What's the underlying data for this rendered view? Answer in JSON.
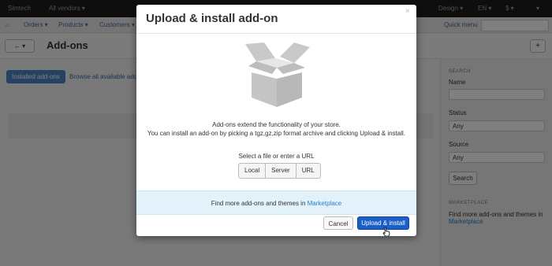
{
  "topbar": {
    "brand": "Simtech",
    "vendors": "All vendors ▾",
    "design": "Design ▾",
    "lang": "EN ▾",
    "currency": "$ ▾",
    "settings": "▾"
  },
  "menubar": {
    "home_icon": "home-icon",
    "orders": "Orders ▾",
    "products": "Products ▾",
    "customers": "Customers ▾",
    "quick_menu": "Quick menu"
  },
  "header": {
    "back": "← ▾",
    "title": "Add-ons",
    "add": "+"
  },
  "tabs": {
    "installed": "Installed add-ons",
    "browse": "Browse all available add"
  },
  "sidebar": {
    "search_heading": "SEARCH",
    "name_label": "Name",
    "status_label": "Status",
    "status_value": "Any",
    "source_label": "Source",
    "source_value": "Any",
    "search_button": "Search",
    "marketplace_heading": "MARKETPLACE",
    "marketplace_text": "Find more add-ons and themes in",
    "marketplace_link": "Marketplace"
  },
  "modal": {
    "title": "Upload & install add-on",
    "close": "×",
    "icon": "open-box-icon",
    "description_line1": "Add-ons extend the functionality of your store.",
    "description_line2": "You can install an add-on by picking a tgz,gz,zip format archive and clicking Upload & install.",
    "select_label": "Select a file or enter a URL",
    "source_options": [
      "Local",
      "Server",
      "URL"
    ],
    "marketplace_text": "Find more add-ons and themes in",
    "marketplace_link": "Marketplace",
    "cancel_label": "Cancel",
    "upload_label": "Upload & install"
  },
  "colors": {
    "primary": "#1a5fc7",
    "link": "#2a7fc9",
    "info_bg": "#e3f1fb"
  }
}
